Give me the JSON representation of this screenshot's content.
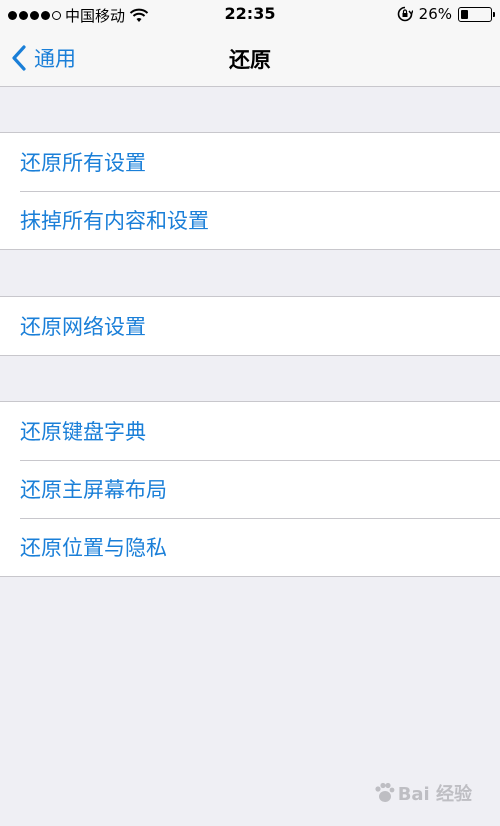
{
  "status_bar": {
    "carrier": "中国移动",
    "time": "22:35",
    "battery_percent": "26%",
    "battery_level": 0.26,
    "signal_bars_filled": 4,
    "signal_bars_total": 5,
    "icons": [
      "wifi-icon",
      "orientation-lock-icon",
      "battery-icon"
    ]
  },
  "nav": {
    "back_label": "通用",
    "title": "还原"
  },
  "groups": [
    {
      "items": [
        "还原所有设置",
        "抹掉所有内容和设置"
      ]
    },
    {
      "items": [
        "还原网络设置"
      ]
    },
    {
      "items": [
        "还原键盘字典",
        "还原主屏幕布局",
        "还原位置与隐私"
      ]
    }
  ],
  "watermark": {
    "text": "Bai 经验"
  },
  "colors": {
    "accent": "#1a7fd8",
    "background": "#efeff4",
    "separator": "#c8c7cc"
  }
}
